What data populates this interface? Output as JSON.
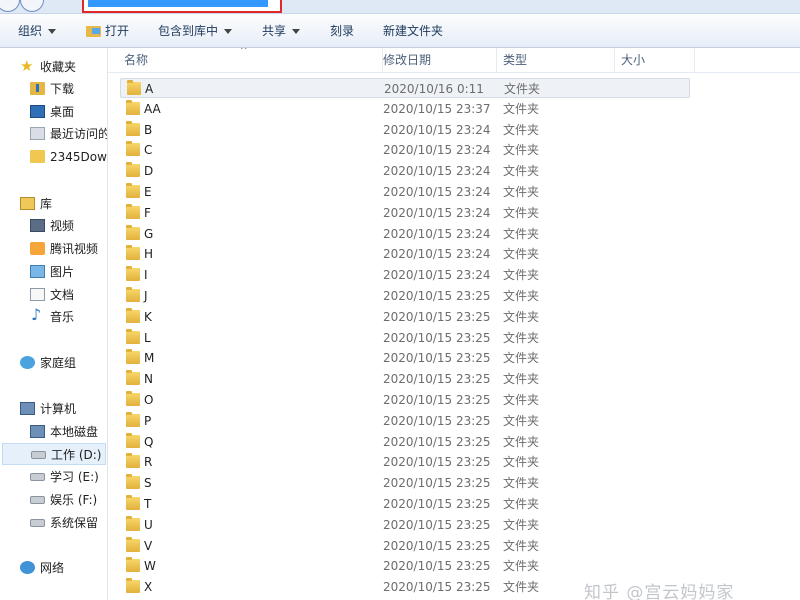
{
  "toolbar": {
    "organize": "组织",
    "open": "打开",
    "include_in_library": "包含到库中",
    "share": "共享",
    "burn": "刻录",
    "new_folder": "新建文件夹"
  },
  "nav": {
    "favorites": "收藏夹",
    "downloads": "下载",
    "desktop": "桌面",
    "recent": "最近访问的",
    "folder_2345": "2345Dow",
    "libraries": "库",
    "videos": "视频",
    "tencent_video": "腾讯视频",
    "pictures": "图片",
    "documents": "文档",
    "music": "音乐",
    "homegroup": "家庭组",
    "computer": "计算机",
    "local_disk": "本地磁盘",
    "work_drive": "工作 (D:)",
    "study_drive": "学习 (E:)",
    "fun_drive": "娱乐 (F:)",
    "system_reserved": "系统保留",
    "network": "网络"
  },
  "columns": {
    "name": "名称",
    "date": "修改日期",
    "type": "类型",
    "size": "大小"
  },
  "files": [
    {
      "name": "A",
      "date": "2020/10/16 0:11",
      "type": "文件夹"
    },
    {
      "name": "AA",
      "date": "2020/10/15 23:37",
      "type": "文件夹"
    },
    {
      "name": "B",
      "date": "2020/10/15 23:24",
      "type": "文件夹"
    },
    {
      "name": "C",
      "date": "2020/10/15 23:24",
      "type": "文件夹"
    },
    {
      "name": "D",
      "date": "2020/10/15 23:24",
      "type": "文件夹"
    },
    {
      "name": "E",
      "date": "2020/10/15 23:24",
      "type": "文件夹"
    },
    {
      "name": "F",
      "date": "2020/10/15 23:24",
      "type": "文件夹"
    },
    {
      "name": "G",
      "date": "2020/10/15 23:24",
      "type": "文件夹"
    },
    {
      "name": "H",
      "date": "2020/10/15 23:24",
      "type": "文件夹"
    },
    {
      "name": "I",
      "date": "2020/10/15 23:24",
      "type": "文件夹"
    },
    {
      "name": "J",
      "date": "2020/10/15 23:25",
      "type": "文件夹"
    },
    {
      "name": "K",
      "date": "2020/10/15 23:25",
      "type": "文件夹"
    },
    {
      "name": "L",
      "date": "2020/10/15 23:25",
      "type": "文件夹"
    },
    {
      "name": "M",
      "date": "2020/10/15 23:25",
      "type": "文件夹"
    },
    {
      "name": "N",
      "date": "2020/10/15 23:25",
      "type": "文件夹"
    },
    {
      "name": "O",
      "date": "2020/10/15 23:25",
      "type": "文件夹"
    },
    {
      "name": "P",
      "date": "2020/10/15 23:25",
      "type": "文件夹"
    },
    {
      "name": "Q",
      "date": "2020/10/15 23:25",
      "type": "文件夹"
    },
    {
      "name": "R",
      "date": "2020/10/15 23:25",
      "type": "文件夹"
    },
    {
      "name": "S",
      "date": "2020/10/15 23:25",
      "type": "文件夹"
    },
    {
      "name": "T",
      "date": "2020/10/15 23:25",
      "type": "文件夹"
    },
    {
      "name": "U",
      "date": "2020/10/15 23:25",
      "type": "文件夹"
    },
    {
      "name": "V",
      "date": "2020/10/15 23:25",
      "type": "文件夹"
    },
    {
      "name": "W",
      "date": "2020/10/15 23:25",
      "type": "文件夹"
    },
    {
      "name": "X",
      "date": "2020/10/15 23:25",
      "type": "文件夹"
    }
  ],
  "watermark": "知乎 @宫云妈妈家"
}
